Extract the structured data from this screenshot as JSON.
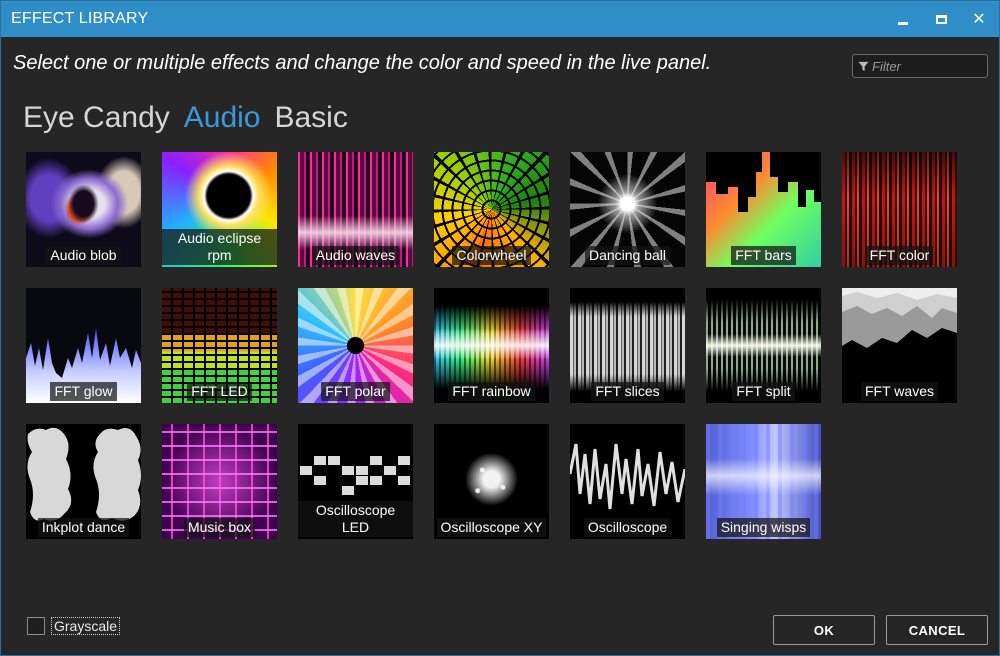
{
  "window": {
    "title": "EFFECT LIBRARY"
  },
  "header": {
    "instruction": "Select one or multiple effects and change the color and speed in the live panel.",
    "filter_placeholder": "Filter"
  },
  "tabs": [
    {
      "label": "Eye Candy",
      "active": false
    },
    {
      "label": "Audio",
      "active": true
    },
    {
      "label": "Basic",
      "active": false
    }
  ],
  "effects": [
    {
      "label": "Audio blob"
    },
    {
      "label": "Audio eclipse rpm"
    },
    {
      "label": "Audio waves"
    },
    {
      "label": "Colorwheel"
    },
    {
      "label": "Dancing ball"
    },
    {
      "label": "FFT bars"
    },
    {
      "label": "FFT color"
    },
    {
      "label": "FFT glow"
    },
    {
      "label": "FFT LED"
    },
    {
      "label": "FFT polar"
    },
    {
      "label": "FFT rainbow"
    },
    {
      "label": "FFT slices"
    },
    {
      "label": "FFT split"
    },
    {
      "label": "FFT waves"
    },
    {
      "label": "Inkplot dance"
    },
    {
      "label": "Music box"
    },
    {
      "label": "Oscilloscope LED"
    },
    {
      "label": "Oscilloscope XY"
    },
    {
      "label": "Oscilloscope"
    },
    {
      "label": "Singing wisps"
    }
  ],
  "footer": {
    "grayscale_label": "Grayscale",
    "grayscale_checked": false,
    "ok_label": "OK",
    "cancel_label": "CANCEL"
  },
  "colors": {
    "titlebar": "#2f8ec8",
    "background": "#262626",
    "active_tab": "#3a9ad9"
  }
}
